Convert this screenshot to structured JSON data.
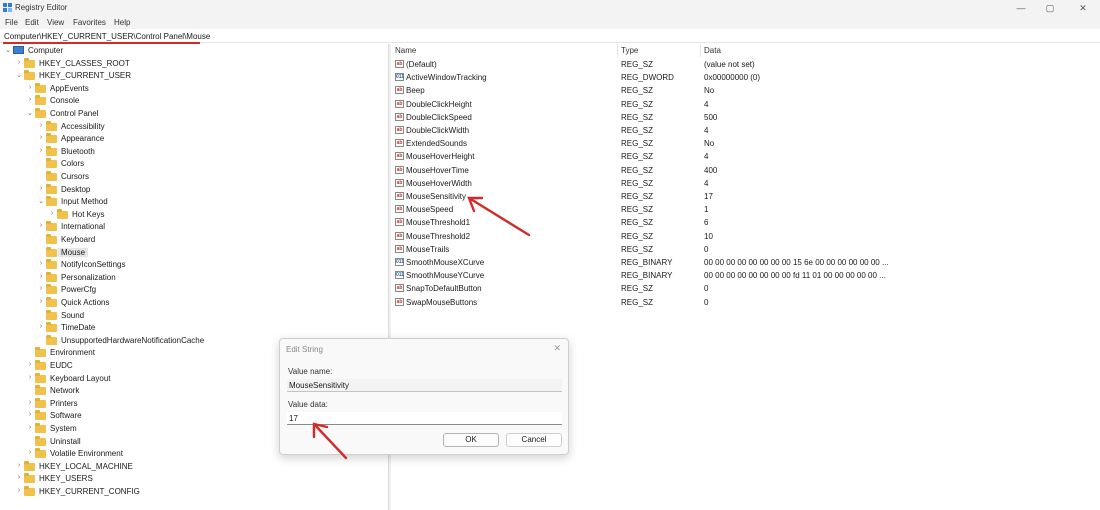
{
  "window": {
    "title": "Registry Editor",
    "minimize": "—",
    "maximize": "▢",
    "close": "✕"
  },
  "menu": [
    "File",
    "Edit",
    "View",
    "Favorites",
    "Help"
  ],
  "address": "Computer\\HKEY_CURRENT_USER\\Control Panel\\Mouse",
  "tree": [
    {
      "label": "Computer",
      "chev": "⌄",
      "kind": "pc"
    },
    {
      "label": "HKEY_CLASSES_ROOT",
      "chev": "›"
    },
    {
      "label": "HKEY_CURRENT_USER",
      "chev": "⌄"
    },
    {
      "label": "AppEvents",
      "chev": "›"
    },
    {
      "label": "Console",
      "chev": "›"
    },
    {
      "label": "Control Panel",
      "chev": "⌄"
    },
    {
      "label": "Accessibility",
      "chev": "›"
    },
    {
      "label": "Appearance",
      "chev": "›"
    },
    {
      "label": "Bluetooth",
      "chev": "›"
    },
    {
      "label": "Colors",
      "chev": ""
    },
    {
      "label": "Cursors",
      "chev": ""
    },
    {
      "label": "Desktop",
      "chev": "›"
    },
    {
      "label": "Input Method",
      "chev": "⌄"
    },
    {
      "label": "Hot Keys",
      "chev": "›"
    },
    {
      "label": "International",
      "chev": "›"
    },
    {
      "label": "Keyboard",
      "chev": ""
    },
    {
      "label": "Mouse",
      "chev": "",
      "selected": true
    },
    {
      "label": "NotifyIconSettings",
      "chev": "›"
    },
    {
      "label": "Personalization",
      "chev": "›"
    },
    {
      "label": "PowerCfg",
      "chev": "›"
    },
    {
      "label": "Quick Actions",
      "chev": "›"
    },
    {
      "label": "Sound",
      "chev": ""
    },
    {
      "label": "TimeDate",
      "chev": "›"
    },
    {
      "label": "UnsupportedHardwareNotificationCache",
      "chev": ""
    },
    {
      "label": "Environment",
      "chev": ""
    },
    {
      "label": "EUDC",
      "chev": "›"
    },
    {
      "label": "Keyboard Layout",
      "chev": "›"
    },
    {
      "label": "Network",
      "chev": ""
    },
    {
      "label": "Printers",
      "chev": "›"
    },
    {
      "label": "Software",
      "chev": "›"
    },
    {
      "label": "System",
      "chev": "›"
    },
    {
      "label": "Uninstall",
      "chev": ""
    },
    {
      "label": "Volatile Environment",
      "chev": "›"
    },
    {
      "label": "HKEY_LOCAL_MACHINE",
      "chev": "›"
    },
    {
      "label": "HKEY_USERS",
      "chev": "›"
    },
    {
      "label": "HKEY_CURRENT_CONFIG",
      "chev": "›"
    }
  ],
  "columns": {
    "name": "Name",
    "type": "Type",
    "data": "Data"
  },
  "values": [
    {
      "name": "(Default)",
      "type": "REG_SZ",
      "data": "(value not set)",
      "icon": "ab"
    },
    {
      "name": "ActiveWindowTracking",
      "type": "REG_DWORD",
      "data": "0x00000000 (0)",
      "icon": "011"
    },
    {
      "name": "Beep",
      "type": "REG_SZ",
      "data": "No",
      "icon": "ab"
    },
    {
      "name": "DoubleClickHeight",
      "type": "REG_SZ",
      "data": "4",
      "icon": "ab"
    },
    {
      "name": "DoubleClickSpeed",
      "type": "REG_SZ",
      "data": "500",
      "icon": "ab"
    },
    {
      "name": "DoubleClickWidth",
      "type": "REG_SZ",
      "data": "4",
      "icon": "ab"
    },
    {
      "name": "ExtendedSounds",
      "type": "REG_SZ",
      "data": "No",
      "icon": "ab"
    },
    {
      "name": "MouseHoverHeight",
      "type": "REG_SZ",
      "data": "4",
      "icon": "ab"
    },
    {
      "name": "MouseHoverTime",
      "type": "REG_SZ",
      "data": "400",
      "icon": "ab"
    },
    {
      "name": "MouseHoverWidth",
      "type": "REG_SZ",
      "data": "4",
      "icon": "ab"
    },
    {
      "name": "MouseSensitivity",
      "type": "REG_SZ",
      "data": "17",
      "icon": "ab"
    },
    {
      "name": "MouseSpeed",
      "type": "REG_SZ",
      "data": "1",
      "icon": "ab"
    },
    {
      "name": "MouseThreshold1",
      "type": "REG_SZ",
      "data": "6",
      "icon": "ab"
    },
    {
      "name": "MouseThreshold2",
      "type": "REG_SZ",
      "data": "10",
      "icon": "ab"
    },
    {
      "name": "MouseTrails",
      "type": "REG_SZ",
      "data": "0",
      "icon": "ab"
    },
    {
      "name": "SmoothMouseXCurve",
      "type": "REG_BINARY",
      "data": "00 00 00 00 00 00 00 00 15 6e 00 00 00 00 00 00 ...",
      "icon": "011"
    },
    {
      "name": "SmoothMouseYCurve",
      "type": "REG_BINARY",
      "data": "00 00 00 00 00 00 00 00 fd 11 01 00 00 00 00 00 ...",
      "icon": "011"
    },
    {
      "name": "SnapToDefaultButton",
      "type": "REG_SZ",
      "data": "0",
      "icon": "ab"
    },
    {
      "name": "SwapMouseButtons",
      "type": "REG_SZ",
      "data": "0",
      "icon": "ab"
    }
  ],
  "dialog": {
    "title": "Edit String",
    "close": "✕",
    "value_name_label": "Value name:",
    "value_name": "MouseSensitivity",
    "value_data_label": "Value data:",
    "value_data": "17",
    "ok": "OK",
    "cancel": "Cancel"
  },
  "colors": {
    "annotation": "#d42a2a",
    "folder": "#f0c24b",
    "selection": "#e5e5e5"
  }
}
